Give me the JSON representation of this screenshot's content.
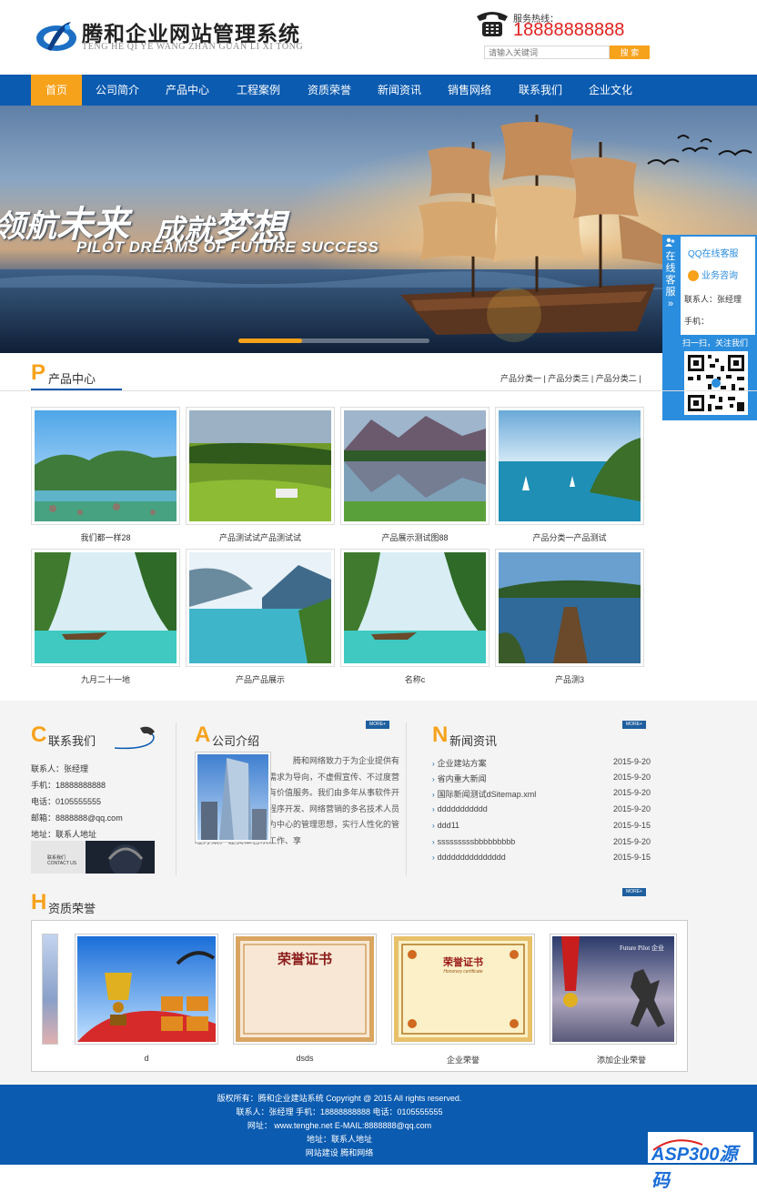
{
  "header": {
    "logo_cn": "腾和企业网站管理系统",
    "logo_en": "TENG HE QI YE WANG ZHAN GUAN LI XI TONG",
    "hotline_label": "服务热线：",
    "hotline_number": "18888888888",
    "search_placeholder": "请输入关键词",
    "search_button": "搜 索"
  },
  "nav": {
    "items": [
      "首页",
      "公司简介",
      "产品中心",
      "工程案例",
      "资质荣誉",
      "新闻资讯",
      "销售网络",
      "联系我们",
      "企业文化"
    ],
    "active_index": 0
  },
  "banner": {
    "text1_small": "领航",
    "text1_big": "未来",
    "text2_small": "成就",
    "text2_big": "梦想",
    "english": "PILOT DREAMS OF FUTURE SUCCESS"
  },
  "qq_float": {
    "side_label": "在线客服",
    "title": "QQ在线客服",
    "consult": "业务咨询",
    "contact": "联系人：张经理",
    "phone": "手机：",
    "scan": "扫一扫，关注我们"
  },
  "products": {
    "letter": "P",
    "title": "产品中心",
    "categories": [
      "产品分类一",
      "产品分类三",
      "产品分类二"
    ],
    "items": [
      {
        "caption": "我们都一样28"
      },
      {
        "caption": "产品测试试产品测试试"
      },
      {
        "caption": "产品展示测试图88"
      },
      {
        "caption": "产品分类一产品测试"
      },
      {
        "caption": "九月二十一地"
      },
      {
        "caption": "产品产品展示"
      },
      {
        "caption": "名称c"
      },
      {
        "caption": "产品测3"
      }
    ]
  },
  "contact": {
    "letter": "C",
    "title": "联系我们",
    "lines": [
      "联系人：张经理",
      "手机：18888888888",
      "电话：0105555555",
      "邮箱：8888888@qq.com",
      "地址：联系人地址"
    ],
    "image_text": "联系我们 CONTACT US"
  },
  "about": {
    "letter": "A",
    "title": "公司介绍",
    "more": "MORE+",
    "text": "腾和网络致力于为企业提供有价值的产品服务，以需求为导向，不虚假宣传、不过度营销。坚持为客户提供有价值服务。我们由多年从事软件开发、网站开发、手机程序开发、网络营销的多名技术人员组建。我们提倡以人为中心的管理思想，实行人性化的管理方案。让员工喜欢工作、享"
  },
  "news": {
    "letter": "N",
    "title": "新闻资讯",
    "more": "MORE+",
    "items": [
      {
        "title": "企业建站方案",
        "date": "2015-9-20"
      },
      {
        "title": "省内重大新闻",
        "date": "2015-9-20"
      },
      {
        "title": "国际新闻测试dSitemap.xml",
        "date": "2015-9-20"
      },
      {
        "title": "ddddddddddd",
        "date": "2015-9-20"
      },
      {
        "title": "ddd11",
        "date": "2015-9-15"
      },
      {
        "title": "sssssssssbbbbbbbbb",
        "date": "2015-9-20"
      },
      {
        "title": "ddddddddddddddd",
        "date": "2015-9-15"
      }
    ]
  },
  "honors": {
    "letter": "H",
    "title": "资质荣誉",
    "more": "MORE+",
    "items": [
      {
        "caption": "d"
      },
      {
        "caption": "dsds"
      },
      {
        "caption": "企业荣誉"
      },
      {
        "caption": "添加企业荣誉"
      }
    ],
    "cert_title_1": "荣誉证书",
    "cert_title_2": "荣誉证书",
    "cert_sub_2": "Honorary certificate",
    "photo_text": "Future Pilot 企业"
  },
  "footer": {
    "line1": "版权所有：腾和企业建站系统 Copyright @ 2015 All rights reserved.",
    "line2": "联系人：张经理 手机：18888888888 电话：0105555555",
    "line3": "网址： www.tenghe.net E-MAIL:8888888@qq.com",
    "line4": "地址：联系人地址",
    "line5": "网站建设 腾和网络",
    "watermark": "ASP300源码"
  },
  "colors": {
    "brand_blue": "#0b5bb0",
    "accent_orange": "#f7a21b",
    "hotline_red": "#e0211e"
  }
}
